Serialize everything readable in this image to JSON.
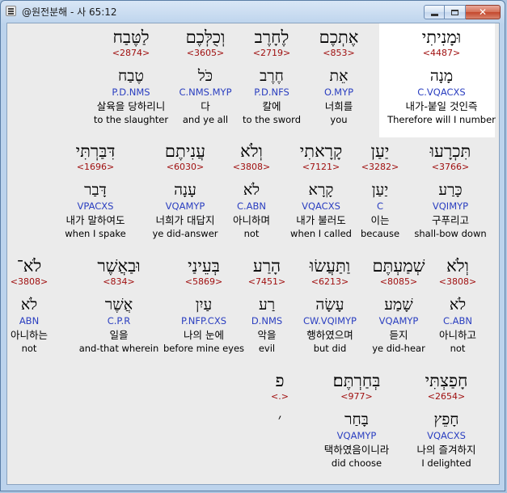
{
  "window": {
    "title": "@원전분해 - 사 65:12",
    "close_glyph": "✕"
  },
  "rows": [
    {
      "words": [
        {
          "heb": "וּמָנִיתִי",
          "strong": "<4487>",
          "lemma": "מָנָה",
          "morph": "C.VQACXS",
          "kor": "내가-붙일 것인즉",
          "eng": "Therefore will I number",
          "highlight": true
        },
        {
          "heb": "אֶתְכֶם",
          "strong": "<853>",
          "lemma": "אֵת",
          "morph": "O.MYP",
          "kor": "너희를",
          "eng": "you"
        },
        {
          "heb": "לֶחָרֶב",
          "strong": "<2719>",
          "lemma": "חֶרֶב",
          "morph": "P.D.NFS",
          "kor": "칼에",
          "eng": "to the sword"
        },
        {
          "heb": "וְכֻלְּכֶם",
          "strong": "<3605>",
          "lemma": "כֹּל",
          "morph": "C.NMS.MYP",
          "kor": "다",
          "eng": "and ye all"
        },
        {
          "heb": "לַטֶּבַח",
          "strong": "<2874>",
          "lemma": "טֶבַח",
          "morph": "P.D.NMS",
          "kor": "살육을 당하리니",
          "eng": "to the slaughter"
        }
      ]
    },
    {
      "words": [
        {
          "heb": "תִּכְרָעוּ",
          "strong": "<3766>",
          "lemma": "כָּרַע",
          "morph": "VQIMYP",
          "kor": "구푸리고",
          "eng": "shall-bow down"
        },
        {
          "heb": "יַעַן",
          "strong": "<3282>",
          "lemma": "יַעַן",
          "morph": "C",
          "kor": "이는",
          "eng": "because"
        },
        {
          "heb": "קָרָאתִי",
          "strong": "<7121>",
          "lemma": "קָרָא",
          "morph": "VQACXS",
          "kor": "내가 불러도",
          "eng": "when I called"
        },
        {
          "heb": "וְלֹא",
          "strong": "<3808>",
          "lemma": "לֹא",
          "morph": "C.ABN",
          "kor": "아니하며",
          "eng": "not"
        },
        {
          "heb": "עֲנִיתֶם",
          "strong": "<6030>",
          "lemma": "עָנָה",
          "morph": "VQAMYP",
          "kor": "너희가 대답지",
          "eng": "ye did-answer"
        },
        {
          "heb": "דִּבַּרְתִּי",
          "strong": "<1696>",
          "lemma": "דָּבַר",
          "morph": "VPACXS",
          "kor": "내가 말하여도",
          "eng": "when I spake"
        }
      ]
    },
    {
      "words": [
        {
          "heb": "וְלֹא",
          "strong": "<3808>",
          "lemma": "לֹא",
          "morph": "C.ABN",
          "kor": "아니하고",
          "eng": "not"
        },
        {
          "heb": "שְׁמַעְתֶּם",
          "strong": "<8085>",
          "lemma": "שָׁמַע",
          "morph": "VQAMYP",
          "kor": "듣지",
          "eng": "ye did-hear"
        },
        {
          "heb": "וַתַּעֲשׂוּ",
          "strong": "<6213>",
          "lemma": "עָשָׂה",
          "morph": "CW.VQIMYP",
          "kor": "행하였으며",
          "eng": "but did"
        },
        {
          "heb": "הָרַע",
          "strong": "<7451>",
          "lemma": "רַע",
          "morph": "D.NMS",
          "kor": "악을",
          "eng": "evil"
        },
        {
          "heb": "בְּעֵינַי",
          "strong": "<5869>",
          "lemma": "עַיִן",
          "morph": "P.NFP.CXS",
          "kor": "나의 눈에",
          "eng": "before mine eyes"
        },
        {
          "heb": "וּבַאֲשֶׁר",
          "strong": "<834>",
          "lemma": "אֲשֶׁר",
          "morph": "C.P.R",
          "kor": "일을",
          "eng": "and-that wherein"
        },
        {
          "heb": "לֹא־",
          "strong": "<3808>",
          "lemma": "לֹא",
          "morph": "ABN",
          "kor": "아니하는",
          "eng": "not"
        }
      ]
    },
    {
      "words": [
        {
          "heb": "חָפַצְתִּי",
          "strong": "<2654>",
          "lemma": "חָפֵץ",
          "morph": "VQACXS",
          "kor": "나의 즐겨하지",
          "eng": "I delighted"
        },
        {
          "heb": "בְּחַרְתֶּם׃",
          "strong": "<977>",
          "lemma": "בָּחַר",
          "morph": "VQAMYP",
          "kor": "택하였음이니라",
          "eng": "did choose"
        },
        {
          "heb": "פ",
          "strong": "<.>",
          "lemma": "׳",
          "morph": "",
          "kor": "",
          "eng": ""
        }
      ]
    }
  ]
}
